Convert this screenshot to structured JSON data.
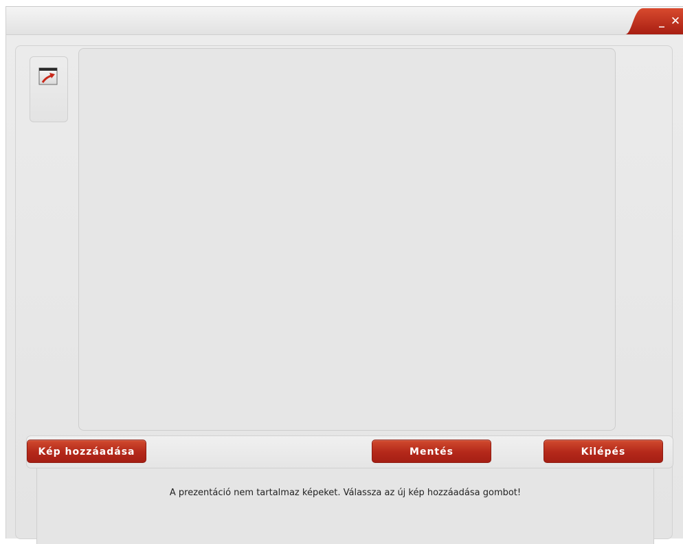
{
  "window": {
    "controls": {
      "minimize_symbol": "_",
      "close_symbol": "✕"
    },
    "accent_color": "#b4281a"
  },
  "sidebar": {
    "export_icon": "export-arrow-icon"
  },
  "toolbar": {
    "add_image_label": "Kép hozzáadása",
    "save_label": "Mentés",
    "exit_label": "Kilépés"
  },
  "message": {
    "text": "A prezentáció nem tartalmaz képeket. Válassza az új kép hozzáadása gombot!"
  }
}
